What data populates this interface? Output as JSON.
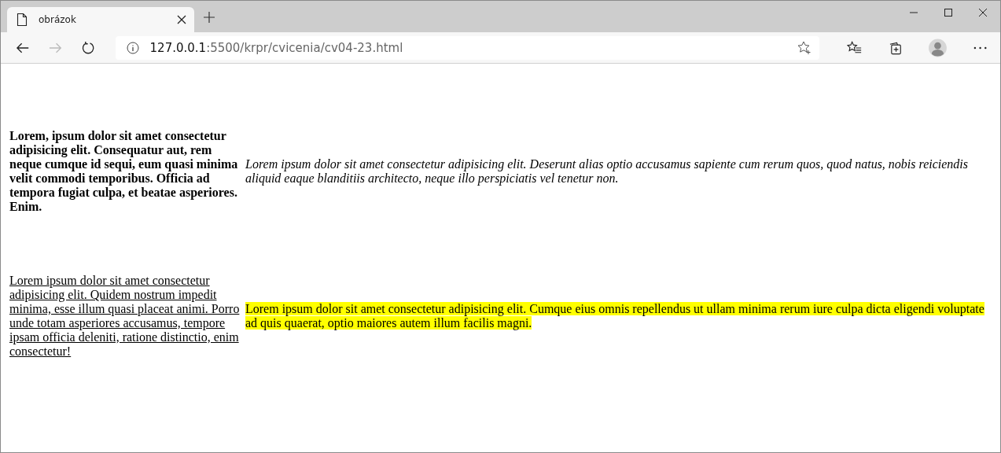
{
  "tab": {
    "title": "obrázok",
    "selected": true
  },
  "address": {
    "host": "127.0.0.1",
    "rest": ":5500/krpr/cvicenia/cv04-23.html"
  },
  "rows": [
    [
      {
        "kind": "bold",
        "text": "Lorem, ipsum dolor sit amet consectetur adipisicing elit. Consequatur aut, rem neque cumque id sequi, eum quasi minima velit commodi temporibus. Officia ad tempora fugiat culpa, et beatae asperiores. Enim."
      },
      {
        "kind": "italic",
        "text": "Lorem ipsum dolor sit amet consectetur adipisicing elit. Deserunt alias optio accusamus sapiente cum rerum quos, quod natus, nobis reiciendis aliquid eaque blanditiis architecto, neque illo perspiciatis vel tenetur non."
      }
    ],
    [
      {
        "kind": "underline",
        "text": "Lorem ipsum dolor sit amet consectetur adipisicing elit. Quidem nostrum impedit minima, esse illum quasi placeat animi. Porro unde totam asperiores accusamus, tempore ipsam officia deleniti, ratione distinctio, enim consectetur!"
      },
      {
        "kind": "highlight",
        "text": "Lorem ipsum dolor sit amet consectetur adipisicing elit. Cumque eius omnis repellendus ut ullam minima rerum iure culpa dicta eligendi voluptate ad quis quaerat, optio maiores autem illum facilis magni."
      }
    ]
  ]
}
